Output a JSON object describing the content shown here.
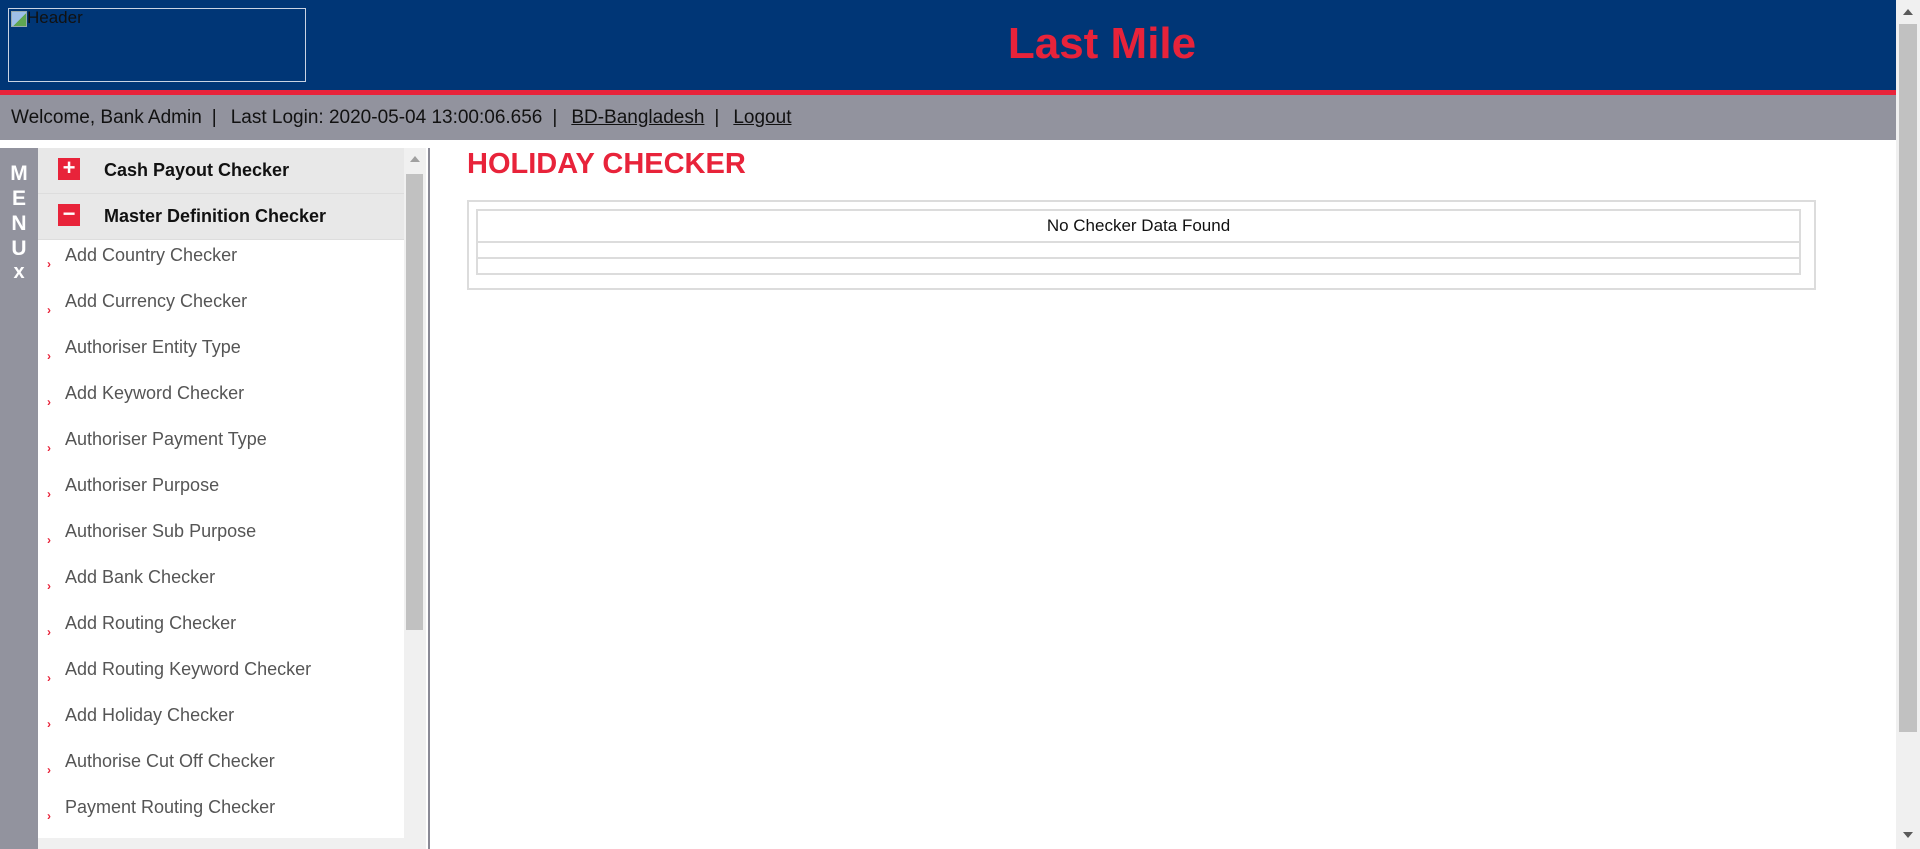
{
  "header": {
    "logo_alt": "Header",
    "title": "Last Mile",
    "colors": {
      "background": "#003676",
      "accent": "#e8233a"
    }
  },
  "infobar": {
    "welcome": "Welcome, Bank Admin",
    "last_login": "Last Login: 2020-05-04 13:00:06.656",
    "country_link": "BD-Bangladesh",
    "logout_link": "Logout",
    "separator": "|"
  },
  "menu_strip": {
    "letters": [
      "M",
      "E",
      "N",
      "U"
    ],
    "close_icon": "x-icon",
    "close_glyph": "x"
  },
  "sidebar": {
    "groups": [
      {
        "label": "Cash Payout Checker",
        "state": "collapsed",
        "toggle_glyph": "+",
        "icon": "plus-icon"
      },
      {
        "label": "Master Definition Checker",
        "state": "expanded",
        "toggle_glyph": "−",
        "icon": "minus-icon"
      }
    ],
    "items": [
      "Add Country Checker",
      "Add Currency Checker",
      "Authoriser Entity Type",
      "Add Keyword Checker",
      "Authoriser Payment Type",
      "Authoriser Purpose",
      "Authoriser Sub Purpose",
      "Add Bank Checker",
      "Add Routing Checker",
      "Add Routing Keyword Checker",
      "Add Holiday Checker",
      "Authorise Cut Off Checker",
      "Payment Routing Checker"
    ],
    "bullet_icon": "arrow-bullet-icon"
  },
  "main": {
    "page_title": "HOLIDAY CHECKER",
    "table_message": "No Checker Data Found"
  }
}
